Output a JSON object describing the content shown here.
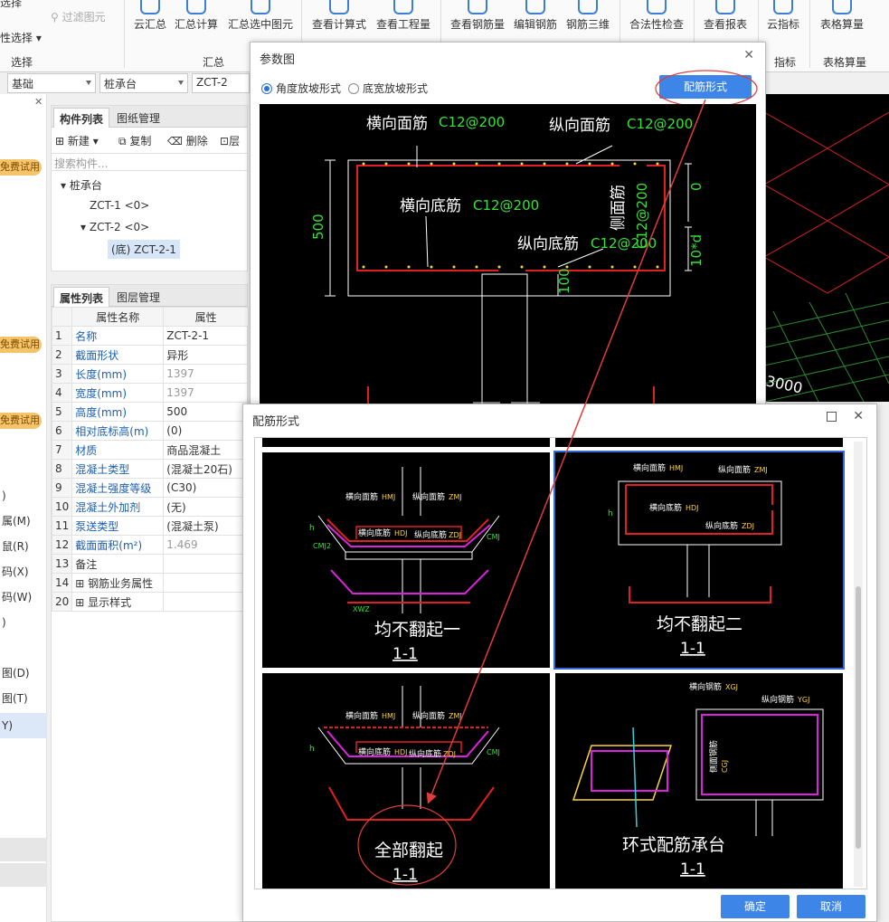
{
  "ribbon": {
    "left_items": [
      "选择",
      "过滤图元",
      "性选择"
    ],
    "buttons": [
      "云汇总",
      "汇总计算",
      "汇总选中图元",
      "查看计算式",
      "查看工程量",
      "查看钢筋量",
      "编辑钢筋",
      "钢筋三维",
      "合法性检查",
      "查看报表",
      "云指标",
      "表格算量"
    ],
    "groups": [
      "选择",
      "汇总",
      "指标",
      "表格算量"
    ]
  },
  "filter": {
    "category": "基础",
    "type": "桩承台",
    "name": "ZCT-2"
  },
  "left": {
    "trial_label": "免费试用",
    "items": [
      ")",
      "属(M)",
      "鼠(R)",
      "码(X)",
      "码(W)",
      ")",
      "图(D)",
      "图(T)",
      "Y)"
    ]
  },
  "component_panel": {
    "tabs": [
      "构件列表",
      "图纸管理"
    ],
    "toolbar": [
      "新建",
      "复制",
      "删除",
      "层"
    ],
    "search_placeholder": "搜索构件...",
    "tree": {
      "root": "桩承台",
      "n1": "ZCT-1 <0>",
      "n2": "ZCT-2 <0>",
      "n3": "(底) ZCT-2-1"
    }
  },
  "property_panel": {
    "tabs": [
      "属性列表",
      "图层管理"
    ],
    "header": {
      "name": "属性名称",
      "value": "属性"
    },
    "rows": [
      {
        "n": "1",
        "k": "名称",
        "v": "ZCT-2-1"
      },
      {
        "n": "2",
        "k": "截面形状",
        "v": "异形"
      },
      {
        "n": "3",
        "k": "长度(mm)",
        "v": "1397"
      },
      {
        "n": "4",
        "k": "宽度(mm)",
        "v": "1397"
      },
      {
        "n": "5",
        "k": "高度(mm)",
        "v": "500"
      },
      {
        "n": "6",
        "k": "相对底标高(m)",
        "v": "(0)"
      },
      {
        "n": "7",
        "k": "材质",
        "v": "商品混凝土"
      },
      {
        "n": "8",
        "k": "混凝土类型",
        "v": "(混凝土20石)"
      },
      {
        "n": "9",
        "k": "混凝土强度等级",
        "v": "(C30)"
      },
      {
        "n": "10",
        "k": "混凝土外加剂",
        "v": "(无)"
      },
      {
        "n": "11",
        "k": "泵送类型",
        "v": "(混凝土泵)"
      },
      {
        "n": "12",
        "k": "截面面积(m²)",
        "v": "1.469"
      },
      {
        "n": "13",
        "k": "备注",
        "v": ""
      },
      {
        "n": "14",
        "k": "钢筋业务属性",
        "v": ""
      },
      {
        "n": "20",
        "k": "显示样式",
        "v": ""
      }
    ]
  },
  "viewport": {
    "dim": "3000"
  },
  "param_dialog": {
    "title": "参数图",
    "radio1": "角度放坡形式",
    "radio2": "底宽放坡形式",
    "button": "配筋形式",
    "labels": {
      "hx_top": "横向面筋",
      "hx_top_v": "C12@200",
      "zx_top": "纵向面筋",
      "zx_top_v": "C12@200",
      "hx_bot": "横向底筋",
      "hx_bot_v": "C12@200",
      "zx_bot": "纵向底筋",
      "zx_bot_v": "C12@200",
      "side": "侧面筋",
      "side_v": "C12@200",
      "h": "500",
      "zero": "0",
      "ten": "10*d",
      "hundred": "100"
    }
  },
  "rebar_dialog": {
    "title": "配筋形式",
    "options": [
      {
        "name": "均不翻起一",
        "section": "1-1"
      },
      {
        "name": "均不翻起二",
        "section": "1-1"
      },
      {
        "name": "全部翻起",
        "section": "1-1"
      },
      {
        "name": "环式配筋承台",
        "section": "1-1"
      }
    ],
    "small": {
      "hmj": "横向面筋",
      "hmj_c": "HMJ",
      "zmj": "纵向面筋",
      "zmj_c": "ZMJ",
      "hdj": "横向底筋",
      "hdj_c": "HDJ",
      "zdj": "纵向底筋",
      "zdj_c": "ZDJ",
      "cmj": "CMJ",
      "xwz": "XWZ",
      "h": "h",
      "cmj2": "CMJ2",
      "hxgj": "横向钢筋",
      "hxgj_c": "XGJ",
      "zxgj": "纵向钢筋",
      "zxgj_c": "YGJ",
      "cgj": "侧面钢筋",
      "cgj_c": "CGJ"
    },
    "ok": "确定",
    "cancel": "取消"
  }
}
